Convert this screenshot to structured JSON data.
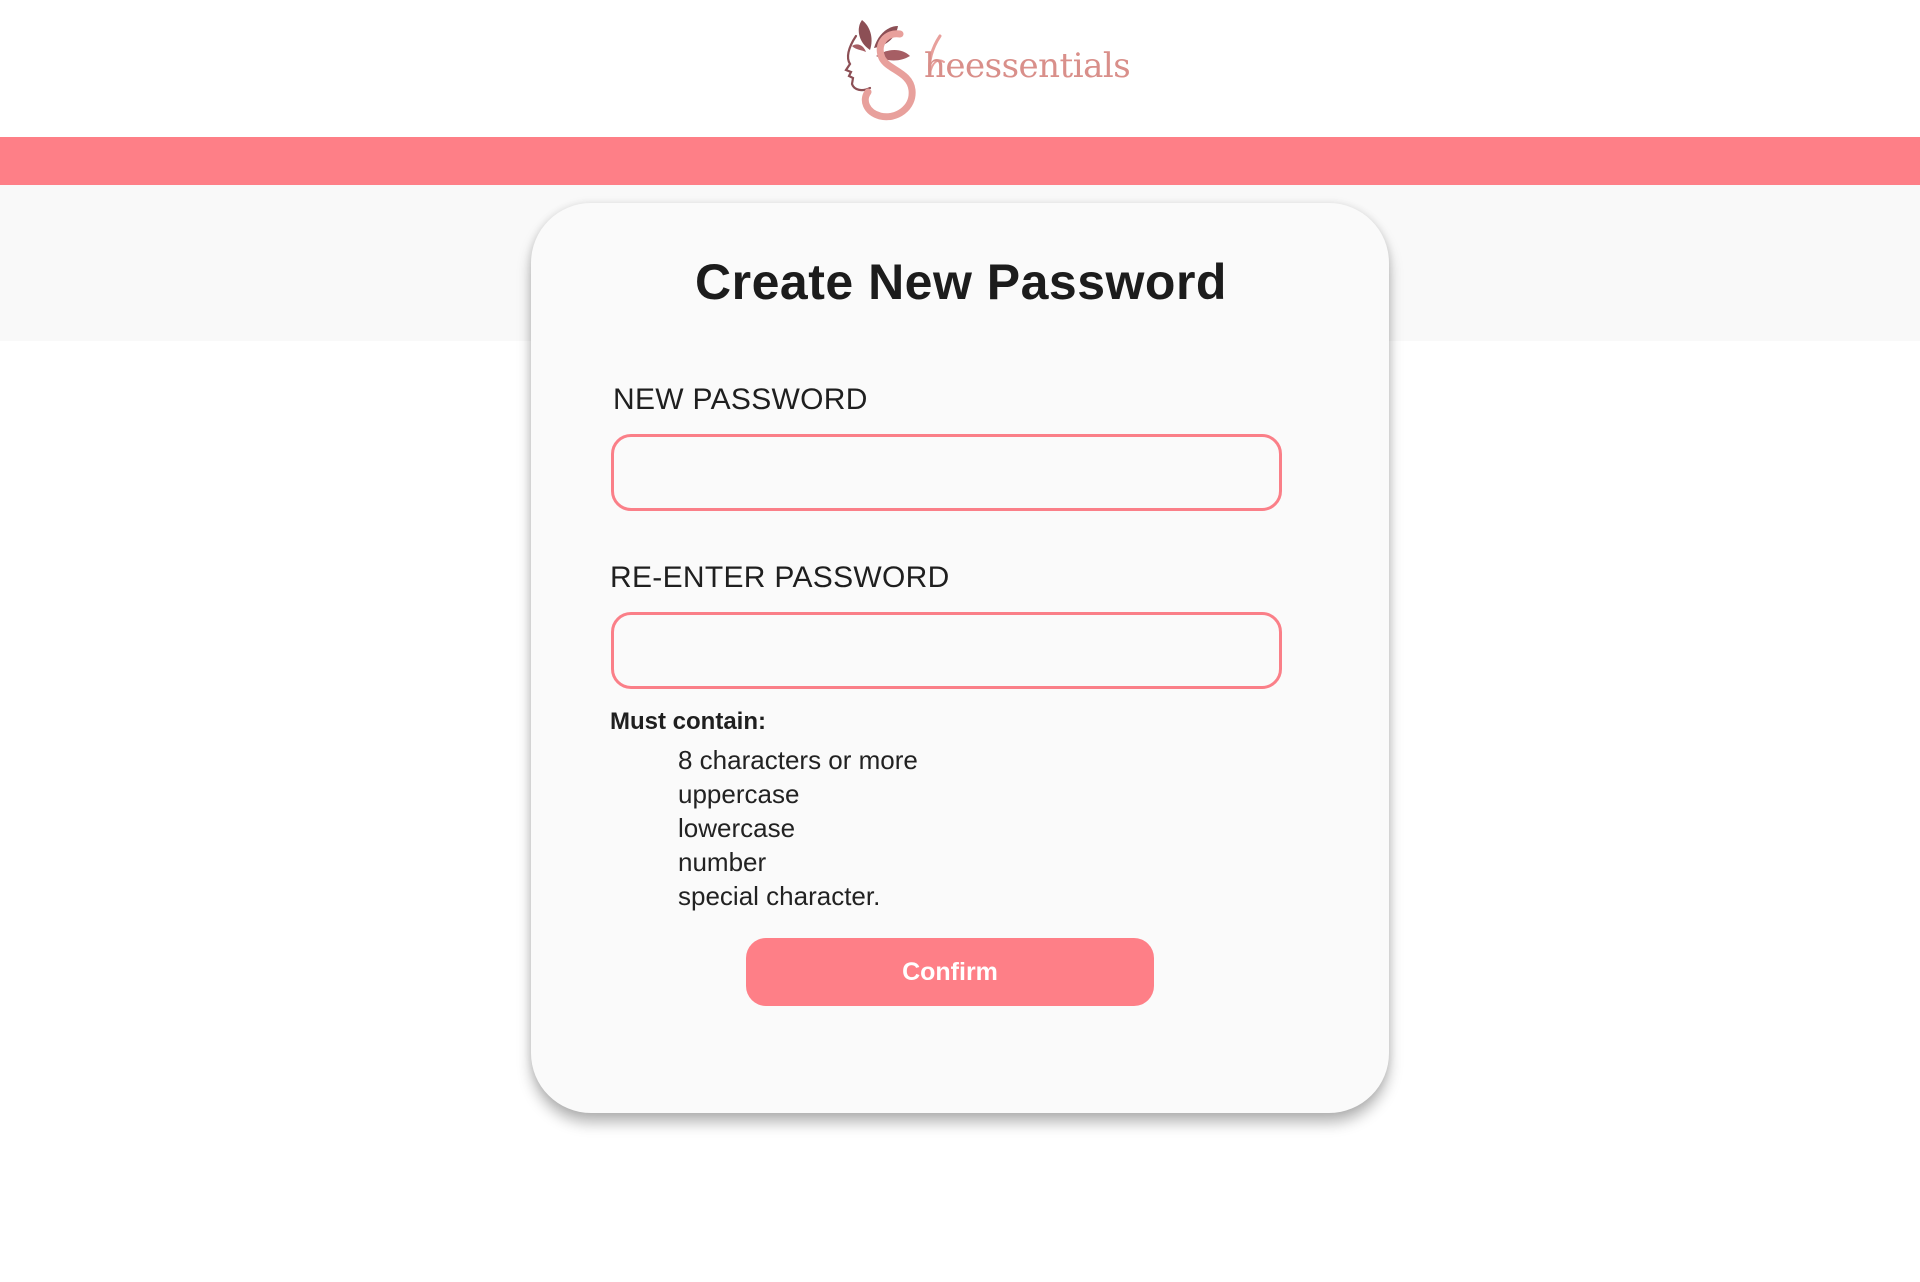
{
  "brand": {
    "wordmark": "heessentials",
    "logo_icon": "woman-face-leaves-logo-icon",
    "colors": {
      "accent": "#fe7f87",
      "logo_leaf": "#8c4f55",
      "logo_swirl": "#e8a09c"
    }
  },
  "form": {
    "title": "Create New Password",
    "new_password_label": "NEW PASSWORD",
    "new_password_value": "",
    "reenter_password_label": "RE-ENTER PASSWORD",
    "reenter_password_value": "",
    "requirements_heading": "Must contain:",
    "requirements": [
      "8 characters or more",
      "uppercase",
      "lowercase",
      "number",
      "special character."
    ],
    "confirm_label": "Confirm"
  }
}
